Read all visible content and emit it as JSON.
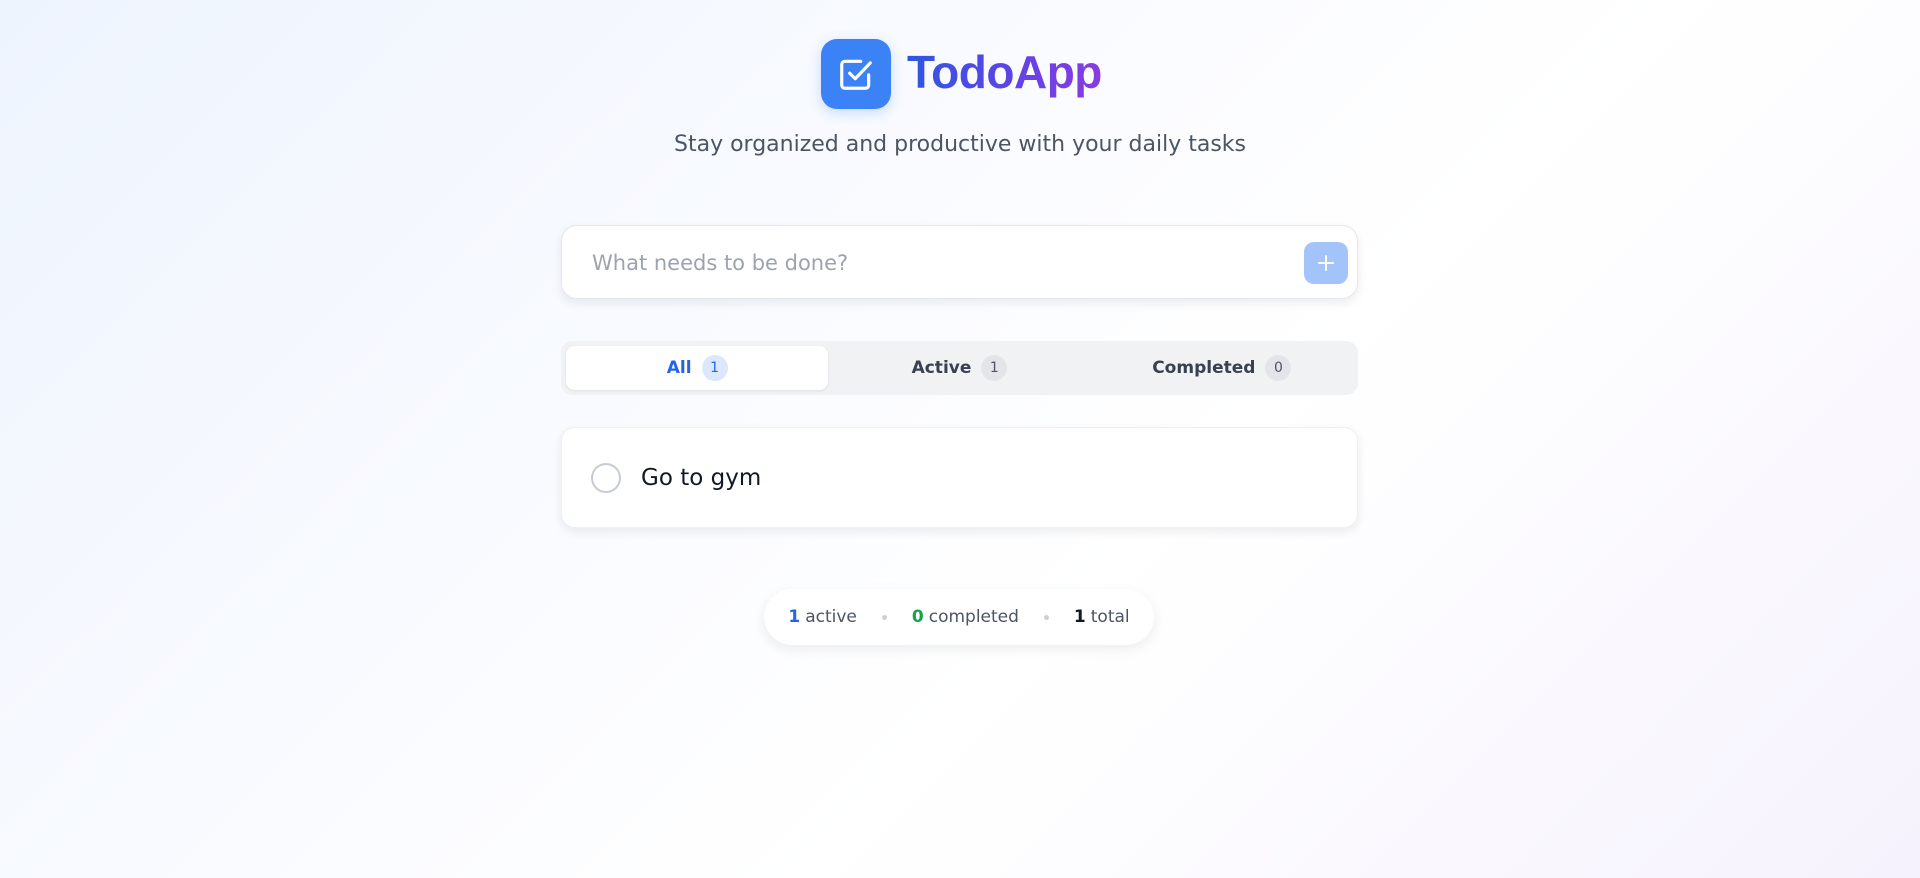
{
  "header": {
    "title": "TodoApp",
    "subtitle": "Stay organized and productive with your daily tasks",
    "logo_icon": "check-square-icon"
  },
  "new_task": {
    "placeholder": "What needs to be done?",
    "value": "",
    "add_icon": "plus-icon"
  },
  "filters": [
    {
      "label": "All",
      "count": "1",
      "selected": true
    },
    {
      "label": "Active",
      "count": "1",
      "selected": false
    },
    {
      "label": "Completed",
      "count": "0",
      "selected": false
    }
  ],
  "todos": [
    {
      "text": "Go to gym",
      "completed": false
    }
  ],
  "stats": {
    "active_count": "1",
    "active_label": "active",
    "completed_count": "0",
    "completed_label": "completed",
    "total_count": "1",
    "total_label": "total"
  },
  "colors": {
    "accent": "#3b82f6",
    "title_gradient_start": "#2f57e0",
    "title_gradient_end": "#8a3be0",
    "completed_green": "#16a34a"
  }
}
